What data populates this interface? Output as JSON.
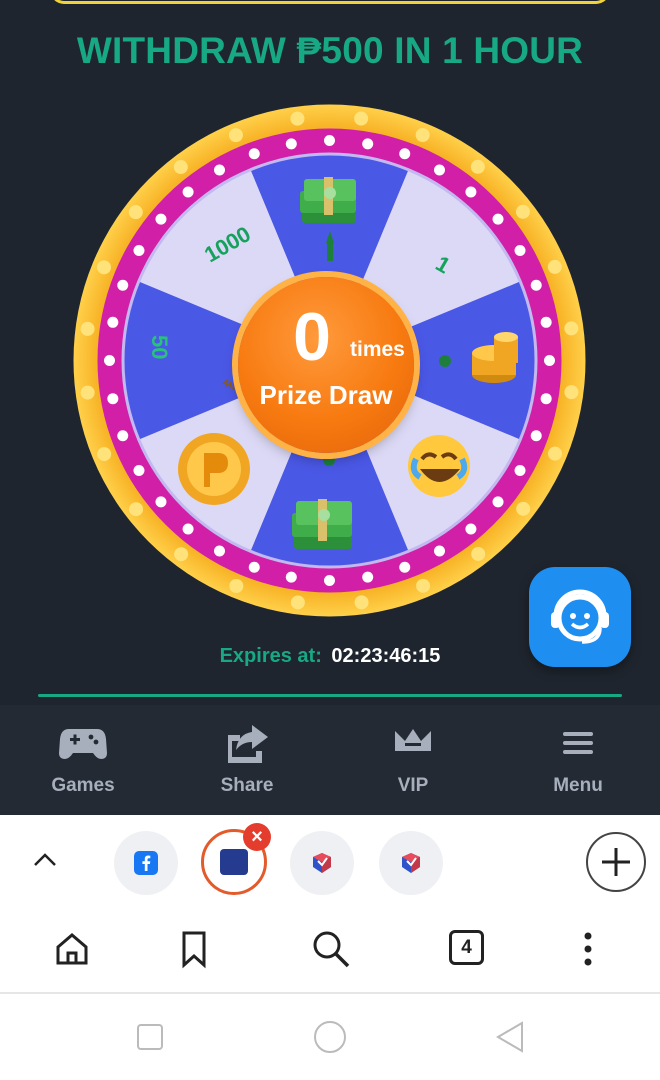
{
  "promo": {
    "headline": "WITHDRAW ₱500 IN 1 HOUR",
    "headline_color": "#17a884"
  },
  "wheel": {
    "rim_color": "#f6b81f",
    "ring_color": "#d11fa7",
    "segment_colors": [
      "#4a58e6",
      "#dcd9f6"
    ],
    "segments": [
      {
        "label": "",
        "icon": "cash-stack-icon"
      },
      {
        "label": "1",
        "icon": ""
      },
      {
        "label": "",
        "icon": "coin-stack-icon"
      },
      {
        "label": "",
        "icon": "laughing-emoji-icon"
      },
      {
        "label": "",
        "icon": "cash-stack-icon"
      },
      {
        "label": "WITHDRAW",
        "icon": "gold-coin-icon"
      },
      {
        "label": "50",
        "icon": ""
      },
      {
        "label": "1000",
        "icon": ""
      }
    ],
    "center": {
      "count": "0",
      "unit": "times",
      "label": "Prize Draw"
    }
  },
  "expires": {
    "label": "Expires at:",
    "time": "02:23:46:15"
  },
  "support": {
    "icon": "customer-support-headset-icon",
    "color": "#1f8ef1"
  },
  "app_nav": {
    "items": [
      {
        "label": "Games",
        "icon": "gamepad-icon"
      },
      {
        "label": "Share",
        "icon": "share-icon"
      },
      {
        "label": "VIP",
        "icon": "crown-icon"
      },
      {
        "label": "Menu",
        "icon": "hamburger-menu-icon"
      }
    ]
  },
  "browser": {
    "tabs": [
      {
        "icon": "facebook-icon"
      },
      {
        "icon": "site-favicon-icon",
        "active": true
      },
      {
        "icon": "cube-app-icon"
      },
      {
        "icon": "cube-app-icon"
      }
    ],
    "tab_count": "4"
  }
}
